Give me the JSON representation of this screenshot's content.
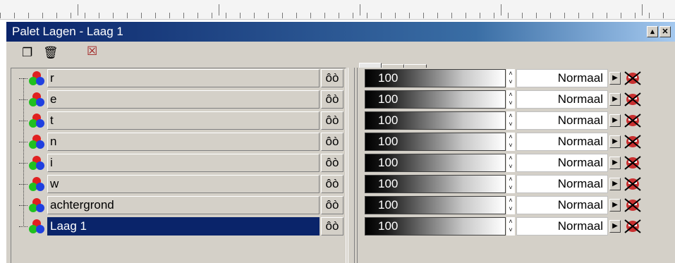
{
  "window": {
    "title": "Palet Lagen - Laag 1",
    "minimize_glyph": "▴",
    "close_glyph": "✕"
  },
  "toolbar": {
    "new_layer_icon": "new-layer-icon",
    "delete_layer_icon": "trash-icon",
    "mask_icon": "mask-icon",
    "new_glyph": "❐",
    "delete_glyph": "🗑",
    "mask_glyph": "☒"
  },
  "tabs": [
    {
      "icon": "eyes-icon",
      "glyph": "☺",
      "active": true
    },
    {
      "icon": "mask-face-icon",
      "glyph": "☹",
      "active": false
    },
    {
      "icon": "layer-groups-icon",
      "glyph": "▥",
      "active": false
    }
  ],
  "layers": [
    {
      "name": "r",
      "opacity": "100",
      "blend": "Normaal",
      "visibility_glyph": "ôò",
      "selected": false
    },
    {
      "name": "e",
      "opacity": "100",
      "blend": "Normaal",
      "visibility_glyph": "ôò",
      "selected": false
    },
    {
      "name": "t",
      "opacity": "100",
      "blend": "Normaal",
      "visibility_glyph": "ôò",
      "selected": false
    },
    {
      "name": "n",
      "opacity": "100",
      "blend": "Normaal",
      "visibility_glyph": "ôò",
      "selected": false
    },
    {
      "name": "i",
      "opacity": "100",
      "blend": "Normaal",
      "visibility_glyph": "ôò",
      "selected": false
    },
    {
      "name": "w",
      "opacity": "100",
      "blend": "Normaal",
      "visibility_glyph": "ôò",
      "selected": false
    },
    {
      "name": "achtergrond",
      "opacity": "100",
      "blend": "Normaal",
      "visibility_glyph": "ôò",
      "selected": false
    },
    {
      "name": "Laag 1",
      "opacity": "100",
      "blend": "Normaal",
      "visibility_glyph": "ôò",
      "selected": true
    }
  ],
  "colors": {
    "title_start": "#0a246a",
    "title_end": "#a6caf0",
    "selection": "#0a246a",
    "panel": "#d4d0c8",
    "rgb_red": "#e02020",
    "rgb_green": "#20c020",
    "rgb_blue": "#2040e0"
  }
}
